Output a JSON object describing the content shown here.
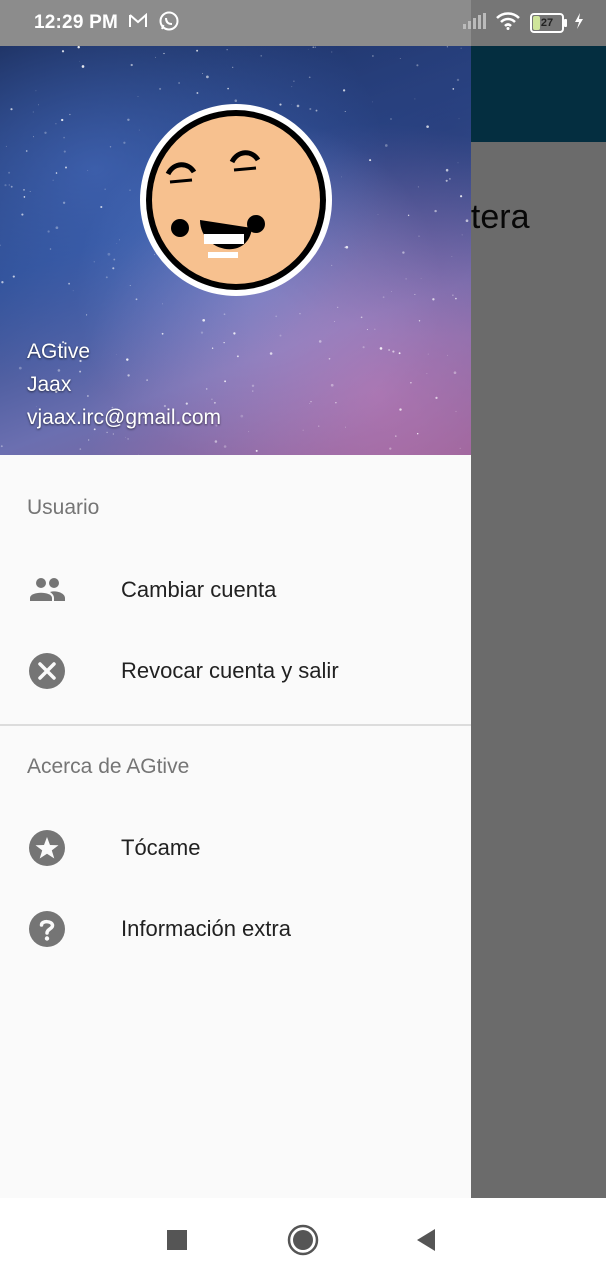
{
  "status_bar": {
    "time": "12:29 PM",
    "notification_icons": [
      "gmail-icon",
      "whatsapp-icon"
    ],
    "battery_percent": "27",
    "battery_level": 0.27,
    "icons": [
      "signal-icon",
      "wifi-icon",
      "battery-icon",
      "charging-icon"
    ]
  },
  "background_app": {
    "visible_text": "ntera",
    "toolbar_color": "#0a6f9a"
  },
  "drawer": {
    "header": {
      "app_name": "AGtive",
      "user_name": "Jaax",
      "email": "vjaax.irc@gmail.com"
    },
    "sections": [
      {
        "title": "Usuario",
        "items": [
          {
            "label": "Cambiar cuenta",
            "icon": "people-icon"
          },
          {
            "label": "Revocar cuenta y salir",
            "icon": "cancel-circle-icon"
          }
        ]
      },
      {
        "title": "Acerca de AGtive",
        "items": [
          {
            "label": "Tócame",
            "icon": "star-circle-icon"
          },
          {
            "label": "Información extra",
            "icon": "help-circle-icon"
          }
        ]
      }
    ]
  },
  "nav_bar": {
    "buttons": [
      "recents-icon",
      "home-icon",
      "back-icon"
    ]
  },
  "colors": {
    "icon_gray": "#757575",
    "drawer_bg": "#fafafa",
    "scrim": "rgba(0,0,0,0.58)"
  }
}
